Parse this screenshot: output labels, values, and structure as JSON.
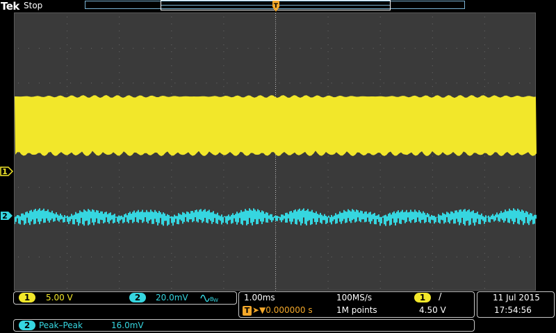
{
  "header": {
    "brand": "Tek",
    "run_state": "Stop"
  },
  "colors": {
    "ch1": "#f2e72a",
    "ch2": "#36d6e0",
    "trigger": "#f4a82a",
    "graticule_bg": "#3a3a3a"
  },
  "markers": {
    "trigger_top": "T",
    "ch1": "1",
    "ch2": "2"
  },
  "channels": {
    "ch1": {
      "number": "1",
      "scale": "5.00 V"
    },
    "ch2": {
      "number": "2",
      "scale": "20.0mV",
      "bw_icon": "bandwidth-limit-icon"
    }
  },
  "timebase": {
    "scale": "1.00ms",
    "sample_rate": "100MS/s",
    "trigger_label": "T",
    "delay": "➤▼0.000000 s",
    "record_length": "1M points"
  },
  "trigger": {
    "source": "1",
    "slope": "/",
    "level": "4.50 V"
  },
  "datetime": {
    "date": "11 Jul  2015",
    "time": "17:54:56"
  },
  "measurement": {
    "source": "2",
    "name": "Peak–Peak",
    "value": "16.0mV"
  }
}
